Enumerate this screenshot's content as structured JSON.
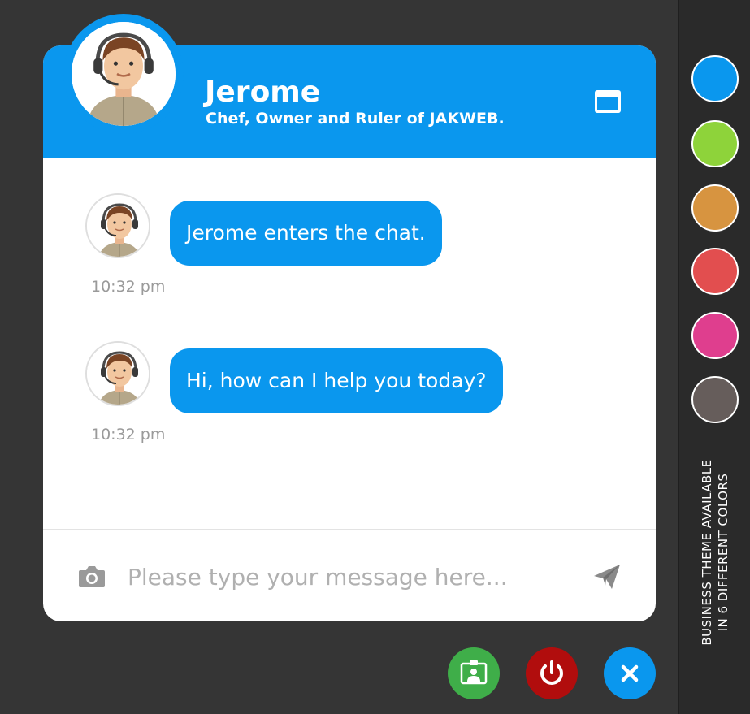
{
  "header": {
    "agent_name": "Jerome",
    "agent_title": "Chef, Owner and Ruler of JAKWEB."
  },
  "messages": [
    {
      "text": "Jerome enters the chat.",
      "time": "10:32 pm"
    },
    {
      "text": "Hi, how can I help you today?",
      "time": "10:32 pm"
    }
  ],
  "composer": {
    "placeholder": "Please type your message here..."
  },
  "theme_bar": {
    "caption_line1": "BUSINESS THEME AVAILABLE",
    "caption_line2": "IN 6 DIFFERENT COLORS",
    "colors": [
      "#0a97ee",
      "#8ed33a",
      "#d79440",
      "#e24e4f",
      "#df3e8e",
      "#665d5b"
    ]
  },
  "colors": {
    "accent": "#0a97ee",
    "contact_button": "#3fae49",
    "power_button": "#b10d0d",
    "close_button": "#0a97ee"
  },
  "icons": {
    "minimize": "window-minimize-icon",
    "camera": "camera-icon",
    "send": "paper-plane-icon",
    "contact": "contact-card-icon",
    "power": "power-icon",
    "close": "close-icon"
  }
}
